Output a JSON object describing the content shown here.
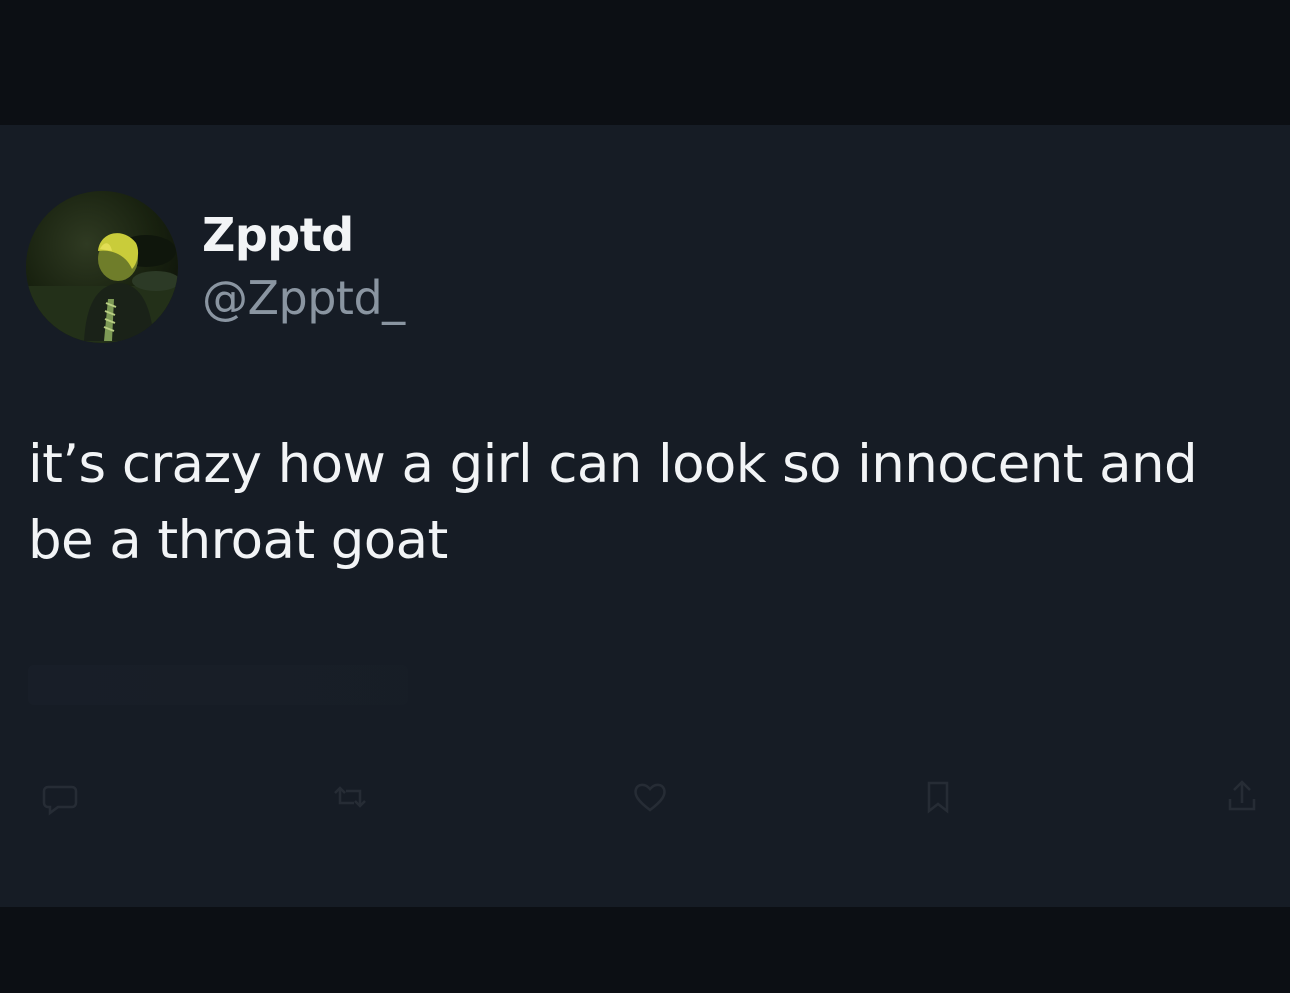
{
  "tweet": {
    "display_name": "Zpptd",
    "handle": "@Zpptd_",
    "text": "it’s crazy how a girl can look so innocent and\nbe a throat goat"
  },
  "actions": [
    {
      "icon": "reply-icon"
    },
    {
      "icon": "retweet-icon"
    },
    {
      "icon": "like-icon"
    },
    {
      "icon": "bookmark-icon"
    },
    {
      "icon": "share-icon"
    }
  ],
  "colors": {
    "page_background": "#0c0f14",
    "card_background": "#161c25",
    "primary_text": "#f2f4f6",
    "secondary_text": "#8a95a1"
  }
}
